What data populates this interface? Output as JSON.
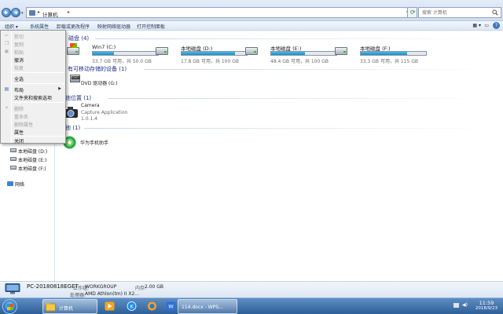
{
  "addressbar": {
    "path_root_sep": "▸",
    "path": "计算机",
    "path_sep": "▸",
    "search_placeholder": "搜索 计算机"
  },
  "toolbar": {
    "organize": "组织 ▾",
    "system_props": "系统属性",
    "uninstall": "卸载或更改程序",
    "map_drive": "映射网络驱动器",
    "control_panel": "打开控制面板"
  },
  "sections": {
    "hard_drives": "磁盘 (4)",
    "removable": "有可移动存储的设备 (1)",
    "other_location": "他位置 (1)",
    "other": "他 (1)"
  },
  "drives": [
    {
      "name": "Win7 (C:)",
      "info": "33.7 GB 可用，共 50.0 GB",
      "used": 0.33
    },
    {
      "name": "本地磁盘 (D:)",
      "info": "17.8 GB 可用，共 100 GB",
      "used": 0.82
    },
    {
      "name": "本地磁盘 (E:)",
      "info": "48.4 GB 可用，共 100 GB",
      "used": 0.52
    },
    {
      "name": "本地磁盘 (F:)",
      "info": "33.3 GB 可用，共 115 GB",
      "used": 0.71
    }
  ],
  "dvd": {
    "name": "DVD 驱动器 (G:)",
    "badge": "DVD"
  },
  "camera": {
    "name": "Camera",
    "desc": "Capture Application",
    "version": "1.0.1.4"
  },
  "huawei": {
    "name": "华为手机助手"
  },
  "navpane": {
    "drive_d": "本地磁盘 (D:)",
    "drive_e": "本地磁盘 (E:)",
    "drive_f": "本地磁盘 (F:)",
    "network": "网络"
  },
  "menu": {
    "cut": "剪切",
    "copy": "复制",
    "paste": "粘贴",
    "undo": "撤消",
    "redo": "恢复",
    "select_all": "全选",
    "layout": "布局",
    "folder_options": "文件夹和搜索选项",
    "delete": "删除",
    "rename": "重命名",
    "remove_props": "删除属性",
    "properties": "属性",
    "close": "关闭"
  },
  "details": {
    "pc_name": "PC-20180818EGET",
    "workgroup_label": "工作组:",
    "workgroup": "WORKGROUP",
    "memory_label": "内存:",
    "memory": "2.00 GB",
    "cpu_label": "处理器:",
    "cpu": "AMD Athlon(tm) II X2..."
  },
  "taskbar": {
    "explorer_label": "计算机",
    "wps_label": "114.docx - WPS..."
  },
  "clock": {
    "time": "11:59",
    "date": "2018/9/23"
  },
  "colors": {
    "accent": "#1f8fc5",
    "section_head": "#1e3287",
    "taskbar": "#2e5f98"
  }
}
